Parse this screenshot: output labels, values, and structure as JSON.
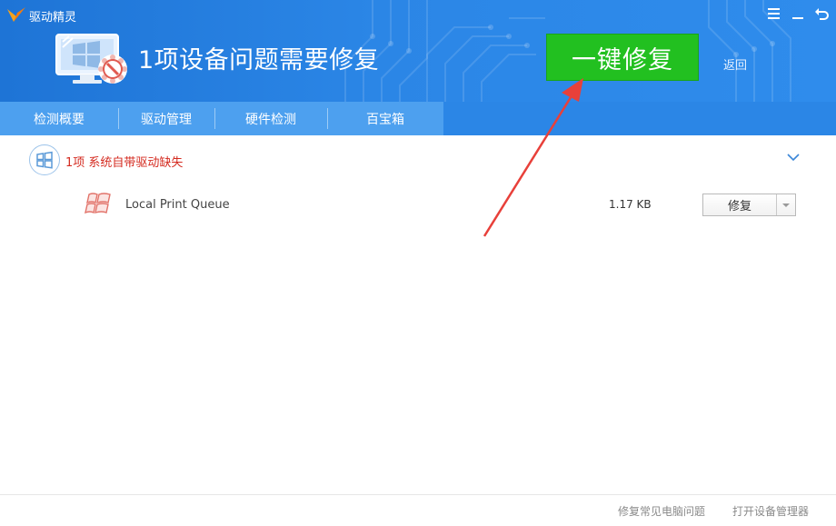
{
  "window": {
    "app_title": "驱动精灵",
    "controls": [
      "menu-icon",
      "minimize-icon",
      "back-arrow-icon"
    ]
  },
  "header": {
    "headline": "1项设备问题需要修复",
    "fix_all_label": "一键修复",
    "back_label": "返回"
  },
  "tabs": [
    {
      "label": "检测概要"
    },
    {
      "label": "驱动管理"
    },
    {
      "label": "硬件检测"
    },
    {
      "label": "百宝箱"
    }
  ],
  "group": {
    "title": "1项 系统自带驱动缺失",
    "icon": "windows-logo-icon"
  },
  "drivers": [
    {
      "name": "Local Print Queue",
      "size": "1.17 KB",
      "action_label": "修复",
      "icon": "windows-flag-icon"
    }
  ],
  "footer": {
    "links": [
      "修复常见电脑问题",
      "打开设备管理器"
    ]
  },
  "colors": {
    "header_blue": "#2b86e6",
    "tab_strip_blue": "#4da0ef",
    "fix_green": "#22c020",
    "alert_red": "#d42a1f",
    "annotation_red": "#e8403a"
  }
}
